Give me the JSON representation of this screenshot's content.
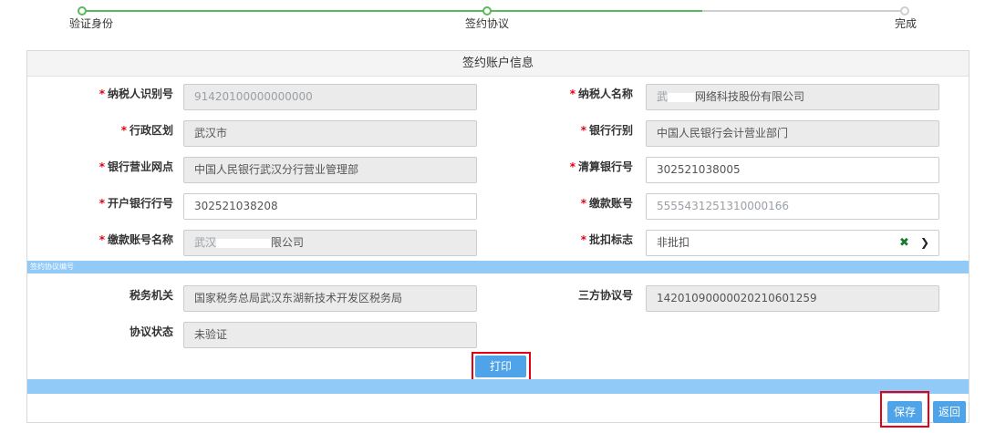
{
  "steps": [
    {
      "label": "验证身份",
      "state": "done"
    },
    {
      "label": "签约协议",
      "state": "done"
    },
    {
      "label": "完成",
      "state": "todo"
    }
  ],
  "panel": {
    "title": "签约账户信息"
  },
  "fields": {
    "taxpayer_id": {
      "label": "纳税人识别号",
      "required": true,
      "value": "91420100000000000"
    },
    "taxpayer_name": {
      "label": "纳税人名称",
      "required": true,
      "value_prefix": "武",
      "value_suffix": "网络科技股份有限公司"
    },
    "region": {
      "label": "行政区划",
      "required": true,
      "value": "武汉市"
    },
    "bank_branch": {
      "label": "银行行别",
      "required": true,
      "value": "中国人民银行会计营业部门"
    },
    "bank_outlet": {
      "label": "银行营业网点",
      "required": true,
      "value": "中国人民银行武汉分行营业管理部"
    },
    "clearing_bank_no": {
      "label": "清算银行号",
      "required": true,
      "value": "302521038005"
    },
    "open_bank_no": {
      "label": "开户银行行号",
      "required": true,
      "value": "302521038208"
    },
    "pay_account_no": {
      "label": "缴款账号",
      "required": true,
      "value": "5555431251310000166"
    },
    "pay_account_name": {
      "label": "缴款账号名称",
      "required": true,
      "value_prefix": "武汉",
      "value_suffix": "限公司"
    },
    "batch_flag": {
      "label": "批扣标志",
      "required": true,
      "value": "非批扣"
    }
  },
  "section": {
    "title": "签约协议编号"
  },
  "agreement": {
    "tax_office": {
      "label": "税务机关",
      "value": "国家税务总局武汉东湖新技术开发区税务局"
    },
    "tripartite_no": {
      "label": "三方协议号",
      "value": "14201090000020210601259"
    },
    "status": {
      "label": "协议状态",
      "value": "未验证"
    }
  },
  "buttons": {
    "print": "打印",
    "save": "保存",
    "back": "返回"
  },
  "colors": {
    "accent_blue": "#4fa3e8",
    "section_blue": "#91c9f7",
    "required_red": "#e60012",
    "step_green": "#5cb85c"
  }
}
